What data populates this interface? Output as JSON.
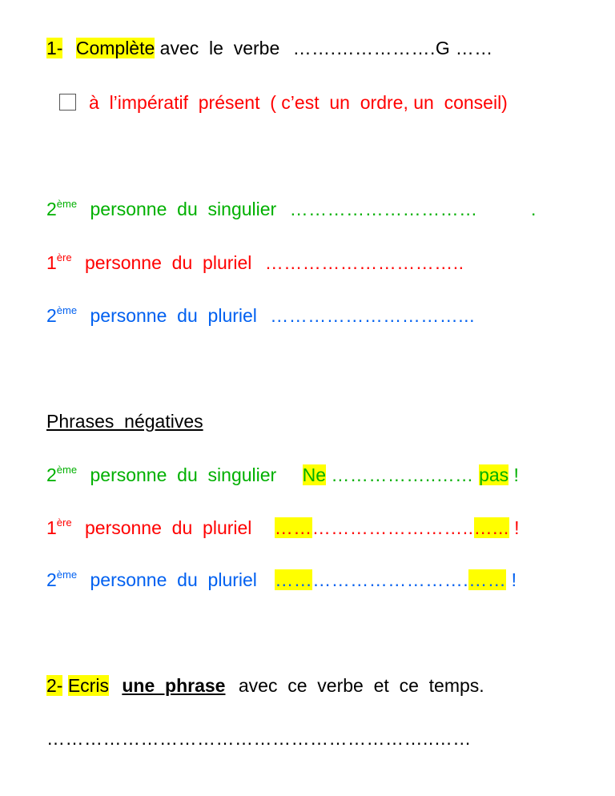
{
  "exercise1": {
    "number": "1-",
    "verb_label": "Complète",
    "instruction": "avec  le  verbe",
    "verb_blank": "…….…………….G",
    "verb_blank_tail": "……",
    "tense_checkbox_checked": false,
    "tense_label": "à  l’impératif  présent  ( c’est  un  ordre, un  conseil)",
    "affirmative": [
      {
        "ordinal": "2",
        "suffix": "ème",
        "label": "personne  du  singulier",
        "blank": "…………………………",
        "tail": ".",
        "color": "#00b000"
      },
      {
        "ordinal": "1",
        "suffix": "ère",
        "label": "personne  du  pluriel",
        "blank": "…………………………..",
        "tail": "",
        "color": "#ff0000"
      },
      {
        "ordinal": "2",
        "suffix": "ème",
        "label": "personne  du  pluriel",
        "blank": "…………………………...",
        "tail": "",
        "color": "#0060f0"
      }
    ],
    "negative_heading": "Phrases  négatives",
    "negative": [
      {
        "ordinal": "2",
        "suffix": "ème",
        "label": "personne  du  singulier",
        "start": "Ne",
        "blank": "……………..……",
        "end": "pas",
        "excl": "!",
        "color": "#00b000"
      },
      {
        "ordinal": "1",
        "suffix": "ère",
        "label": "personne  du  pluriel",
        "start": "……",
        "blank": "……………………..",
        "end": "…...",
        "excl": "!",
        "color": "#ff0000"
      },
      {
        "ordinal": "2",
        "suffix": "ème",
        "label": "personne  du  pluriel",
        "start": "……",
        "blank": "…………………….",
        "end": "……",
        "excl": "!",
        "color": "#0060f0"
      }
    ]
  },
  "exercise2": {
    "number": "2-",
    "verb_label": "Ecris",
    "emphasis": "une  phrase",
    "instruction": "avec  ce  verbe  et  ce  temps.",
    "answer_line": "……………………………………………………..……"
  },
  "colors": {
    "highlight": "#ffff00",
    "text": "#000000",
    "red": "#ff0000",
    "green": "#00b000",
    "blue": "#0060f0"
  }
}
